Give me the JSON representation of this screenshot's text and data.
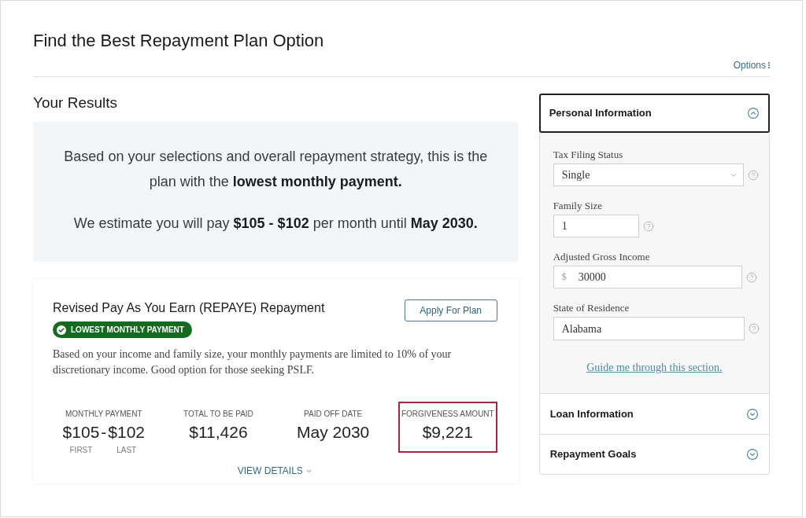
{
  "page": {
    "title": "Find the Best Repayment Plan Option",
    "options_link": "Options"
  },
  "results": {
    "heading": "Your Results",
    "summary": [
      "Based on your selections and overall repayment strategy, this is the plan with the **lowest monthly payment.**",
      "We estimate you will pay **$105 - $102** per month until **May 2030.**"
    ]
  },
  "plan": {
    "title": "Revised Pay As You Earn (REPAYE) Repayment",
    "badge": "LOWEST MONTHLY PAYMENT",
    "apply_button": "Apply For Plan",
    "description": "Based on your income and family size, your monthly payments are limited to 10% of your discretionary income. Good option for those seeking PSLF.",
    "stats": [
      {
        "kind": "range",
        "label": "MONTHLY PAYMENT",
        "first_value": "$105",
        "separator": "-",
        "last_value": "$102",
        "first_caption": "FIRST",
        "last_caption": "LAST",
        "highlighted": false
      },
      {
        "kind": "single",
        "label": "TOTAL TO BE PAID",
        "value": "$11,426",
        "highlighted": false
      },
      {
        "kind": "single",
        "label": "PAID OFF DATE",
        "value": "May 2030",
        "highlighted": false
      },
      {
        "kind": "single",
        "label": "FORGIVENESS AMOUNT",
        "value": "$9,221",
        "highlighted": true
      }
    ],
    "view_details": "VIEW DETAILS"
  },
  "sidebar": {
    "sections": [
      {
        "title": "Personal Information",
        "expanded": true,
        "fields": [
          {
            "kind": "select",
            "label": "Tax Filing Status",
            "value": "Single"
          },
          {
            "kind": "number",
            "label": "Family Size",
            "value": "1"
          },
          {
            "kind": "currency",
            "label": "Adjusted Gross Income",
            "prefix": "$",
            "value": "30000"
          },
          {
            "kind": "text",
            "label": "State of Residence",
            "value": "Alabama"
          }
        ],
        "guide_link": "Guide me through this section."
      },
      {
        "title": "Loan Information",
        "expanded": false
      },
      {
        "title": "Repayment Goals",
        "expanded": false
      }
    ]
  }
}
